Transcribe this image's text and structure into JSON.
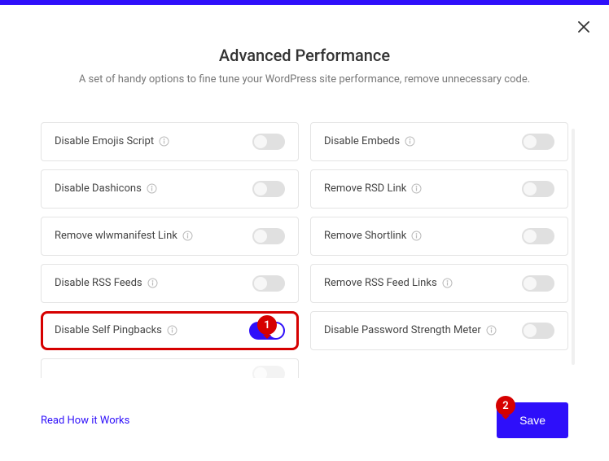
{
  "header": {
    "title": "Advanced Performance",
    "subtitle": "A set of handy options to fine tune your WordPress site performance, remove unnecessary code."
  },
  "options": {
    "left": [
      {
        "label": "Disable Emojis Script",
        "on": false,
        "highlighted": false
      },
      {
        "label": "Disable Dashicons",
        "on": false,
        "highlighted": false
      },
      {
        "label": "Remove wlwmanifest Link",
        "on": false,
        "highlighted": false
      },
      {
        "label": "Disable RSS Feeds",
        "on": false,
        "highlighted": false
      },
      {
        "label": "Disable Self Pingbacks",
        "on": true,
        "highlighted": true
      }
    ],
    "right": [
      {
        "label": "Disable Embeds",
        "on": false,
        "highlighted": false
      },
      {
        "label": "Remove RSD Link",
        "on": false,
        "highlighted": false
      },
      {
        "label": "Remove Shortlink",
        "on": false,
        "highlighted": false
      },
      {
        "label": "Remove RSS Feed Links",
        "on": false,
        "highlighted": false
      },
      {
        "label": "Disable Password Strength Meter",
        "on": false,
        "highlighted": false
      }
    ]
  },
  "footer": {
    "link": "Read How it Works",
    "save": "Save"
  },
  "markers": {
    "m1": "1",
    "m2": "2"
  }
}
